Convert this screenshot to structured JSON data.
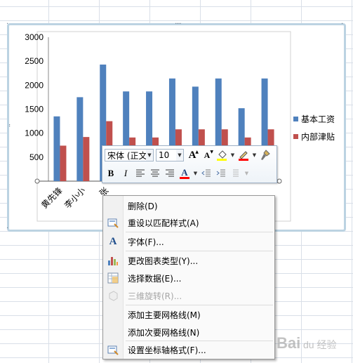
{
  "chart_data": {
    "type": "bar",
    "categories": [
      "黄先锋",
      "李小小",
      "张",
      "",
      "",
      "",
      "",
      "",
      "",
      ""
    ],
    "series": [
      {
        "name": "基本工资",
        "color": "#4f81bd",
        "values": [
          1350,
          1750,
          2430,
          1870,
          1870,
          2140,
          1970,
          2140,
          1520,
          2140
        ]
      },
      {
        "name": "内部津贴",
        "color": "#c0504d",
        "values": [
          740,
          920,
          1250,
          910,
          910,
          1080,
          1080,
          1080,
          910,
          1080
        ]
      }
    ],
    "ylim": [
      0,
      3000
    ],
    "yticks": [
      "3000",
      "2500",
      "2000",
      "1500",
      "1000",
      "500"
    ],
    "grid": false,
    "legend_position": "right"
  },
  "toolbar": {
    "font_name": "宋体 (正文",
    "font_size": "10",
    "grow_font": "A",
    "shrink_font": "A",
    "bold": "B",
    "italic": "I",
    "font_color_glyph": "A",
    "fill_color": "#ffff00",
    "highlight_color": "#ff0000"
  },
  "context_menu": {
    "items": [
      {
        "label": "删除(D)",
        "icon": "",
        "enabled": true
      },
      {
        "label": "重设以匹配样式(A)",
        "icon": "reset-style-icon",
        "enabled": true
      },
      {
        "label": "字体(F)...",
        "icon": "font-icon",
        "enabled": true
      },
      {
        "label": "更改图表类型(Y)...",
        "icon": "chart-type-icon",
        "enabled": true
      },
      {
        "label": "选择数据(E)...",
        "icon": "select-data-icon",
        "enabled": true
      },
      {
        "label": "三维旋转(R)...",
        "icon": "3d-rotation-icon",
        "enabled": false
      },
      {
        "label": "添加主要网格线(M)",
        "icon": "",
        "enabled": true
      },
      {
        "label": "添加次要网格线(N)",
        "icon": "",
        "enabled": true
      },
      {
        "label": "设置坐标轴格式(F)...",
        "icon": "format-axis-icon",
        "enabled": true
      }
    ]
  },
  "watermark": {
    "text": "Baidu 经验"
  }
}
